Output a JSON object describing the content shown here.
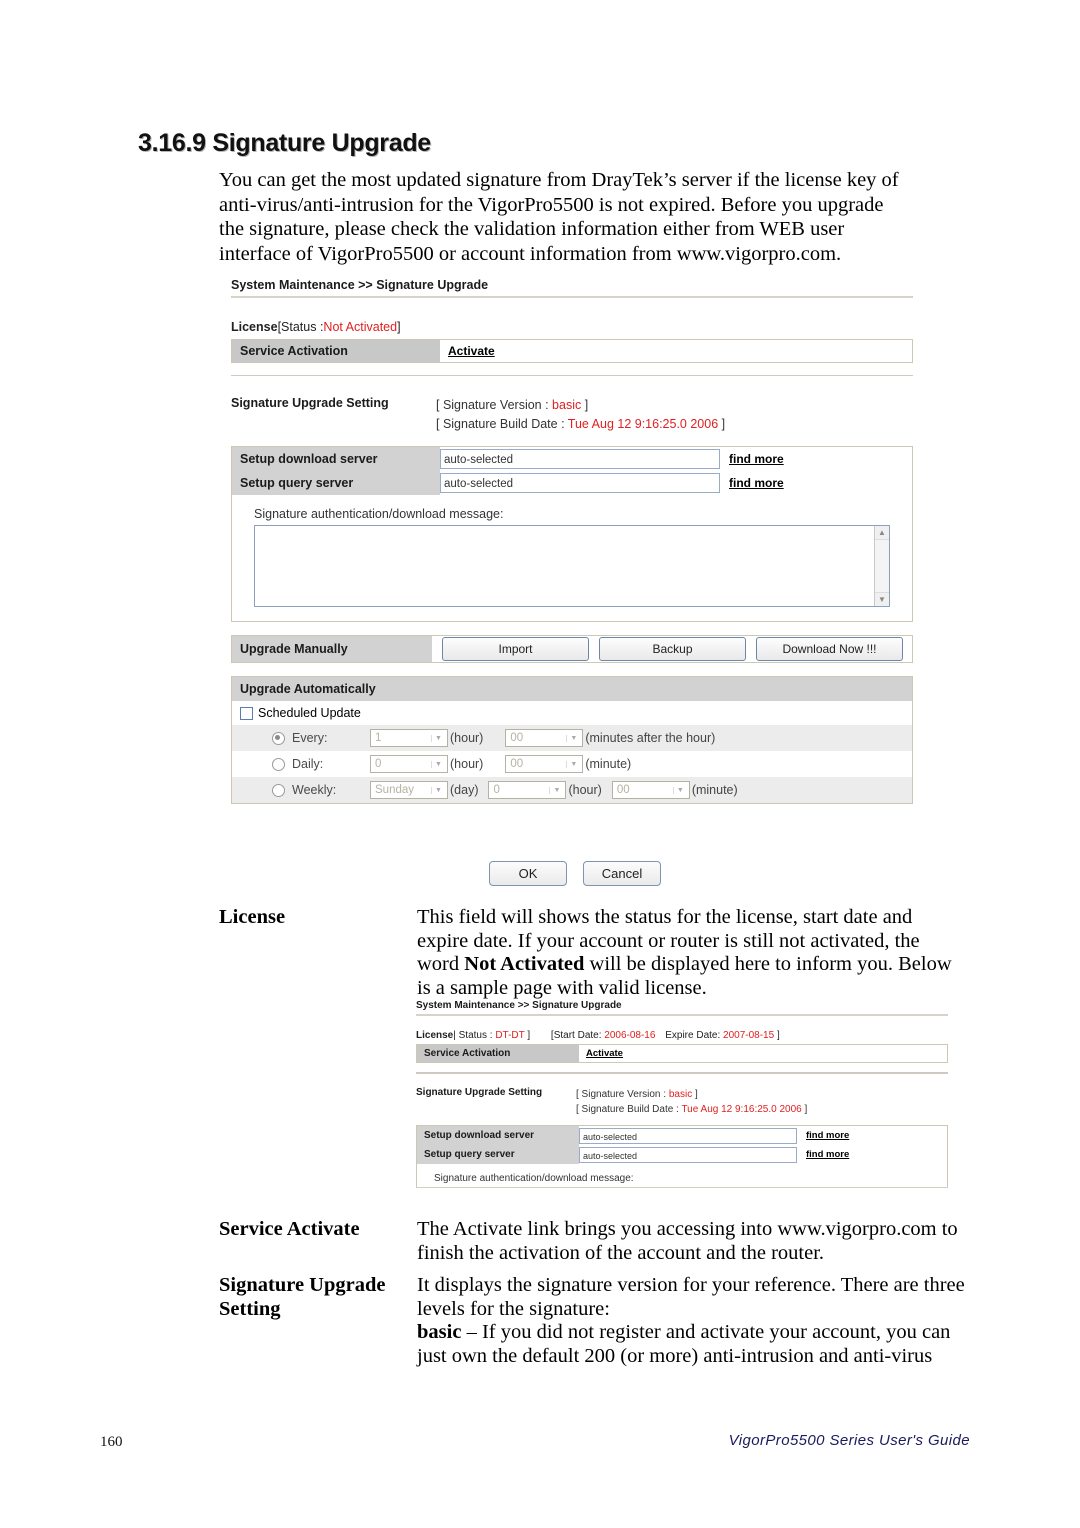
{
  "page": {
    "section_number": "3.16.9",
    "heading": "3.16.9 Signature Upgrade",
    "intro": "You can get the most updated signature from DrayTek’s server if the license key of anti-virus/anti-intrusion for the VigorPro5500 is not expired. Before you upgrade the signature, please check the validation information either from WEB user interface of VigorPro5500 or account information from www.vigorpro.com.",
    "page_number": "160",
    "footer_guide": "VigorPro5500 Series User's Guide"
  },
  "screenshot_main": {
    "breadcrumb": "System Maintenance >> Signature Upgrade",
    "license_label": "License",
    "license_status_prefix": "[Status :",
    "license_status_value": "Not Activated",
    "license_status_suffix": "]",
    "service_activation_label": "Service Activation",
    "activate_link": "Activate",
    "setting_label": "Signature Upgrade Setting",
    "setting_version_line_prefix": "[ Signature Version : ",
    "setting_version_value": "basic",
    "setting_version_line_suffix": " ]",
    "setting_build_line_prefix": "[ Signature Build Date : ",
    "setting_build_value": "Tue Aug 12 9:16:25.0 2006",
    "setting_build_line_suffix": " ]",
    "download_server_label": "Setup download server",
    "download_server_value": "auto-selected",
    "download_server_link": "find more",
    "query_server_label": "Setup query server",
    "query_server_value": "auto-selected",
    "query_server_link": "find more",
    "message_label": "Signature authentication/download message:",
    "message_value": "",
    "upgrade_manually_label": "Upgrade Manually",
    "import_button": "Import",
    "backup_button": "Backup",
    "download_now_button": "Download Now !!!",
    "upgrade_automatically_label": "Upgrade Automatically",
    "scheduled_update_label": "Scheduled Update",
    "scheduled_update_checked": false,
    "schedule_rows": [
      {
        "name": "every",
        "label": "Every:",
        "selected": true,
        "field1_value": "1",
        "field1_unit": "(hour)",
        "field2_value": "00",
        "field2_unit": "(minutes after the hour)",
        "field3_value": null,
        "field3_unit": null
      },
      {
        "name": "daily",
        "label": "Daily:",
        "selected": false,
        "field1_value": "0",
        "field1_unit": "(hour)",
        "field2_value": "00",
        "field2_unit": "(minute)",
        "field3_value": null,
        "field3_unit": null
      },
      {
        "name": "weekly",
        "label": "Weekly:",
        "selected": false,
        "field1_value": "Sunday",
        "field1_unit": "(day)",
        "field2_value": "0",
        "field2_unit": "(hour)",
        "field3_value": "00",
        "field3_unit": "(minute)"
      }
    ],
    "ok_button": "OK",
    "cancel_button": "Cancel"
  },
  "screenshot_sample": {
    "breadcrumb": "System Maintenance >> Signature Upgrade",
    "license_label": "License",
    "status_prefix": "| Status : ",
    "status_value": "DT-DT",
    "status_suffix": " ]",
    "start_date_label": "[Start Date: ",
    "start_date_value": "2006-08-16",
    "expire_date_label": "Expire Date: ",
    "expire_date_value": "2007-08-15",
    "expire_suffix": " ]",
    "service_activation_label": "Service Activation",
    "activate_link": "Activate",
    "setting_label": "Signature Upgrade Setting",
    "setting_version_line_prefix": "[ Signature Version : ",
    "setting_version_value": "basic",
    "setting_version_line_suffix": " ]",
    "setting_build_line_prefix": "[ Signature Build Date : ",
    "setting_build_value": "Tue Aug 12 9:16:25.0 2006",
    "setting_build_line_suffix": " ]",
    "download_server_label": "Setup download server",
    "download_server_value": "auto-selected",
    "download_server_link": "find more",
    "query_server_label": "Setup query server",
    "query_server_value": "auto-selected",
    "query_server_link": "find more",
    "message_label": "Signature authentication/download message:"
  },
  "definitions": {
    "license": {
      "term": "License",
      "desc_part1": "This field will shows the status for the license, start date and expire date. If your account or router is still not activated, the word ",
      "desc_bold1": "Not Activated",
      "desc_part2": " will be displayed here to inform you. Below is a sample page with valid license."
    },
    "service_activate": {
      "term": "Service Activate",
      "desc": "The Activate link brings you accessing into www.vigorpro.com to finish the activation of the account and the router."
    },
    "signature_upgrade_setting": {
      "term_line1": "Signature Upgrade",
      "term_line2": "Setting",
      "desc_part1": "It displays the signature version for your reference. There are three levels for the signature:",
      "desc_bold1": "basic",
      "desc_part2": " – If you did not register and activate your account, you can just own the default 200 (or more) anti-intrusion and anti-virus"
    }
  },
  "colors": {
    "status_red": "#e02020",
    "header_gray": "#c8c8c8",
    "panel_border": "#cdc7b4"
  }
}
